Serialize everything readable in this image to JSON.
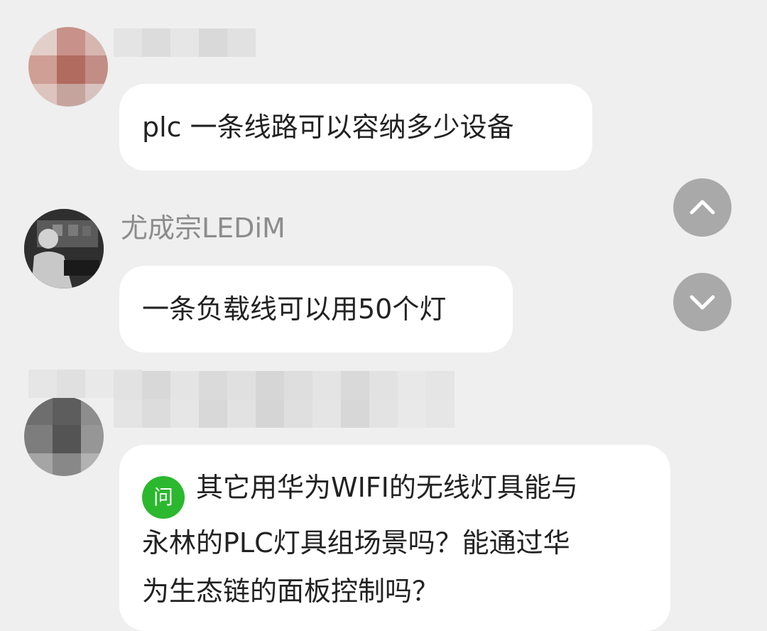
{
  "messages": [
    {
      "sender_name": "",
      "sender_obscured": true,
      "text": "plc 一条线路可以容纳多少设备"
    },
    {
      "sender_name": "尤成宗LEDiM",
      "sender_obscured": false,
      "text": "一条负载线可以用50个灯"
    },
    {
      "sender_name": "",
      "sender_obscured": true,
      "badge": "问",
      "text_lines": [
        "其它用华为WIFI的无线灯具能与",
        "永林的PLC灯具组场景吗？能通过华",
        "为生态链的面板控制吗？"
      ]
    }
  ],
  "nav": {
    "up_icon": "chevron-up-icon",
    "down_icon": "chevron-down-icon"
  },
  "colors": {
    "background": "#efefef",
    "bubble": "#ffffff",
    "sender_name": "#8c8c8c",
    "question_badge": "#2bb82e",
    "nav_button": "#a9a9a9"
  }
}
